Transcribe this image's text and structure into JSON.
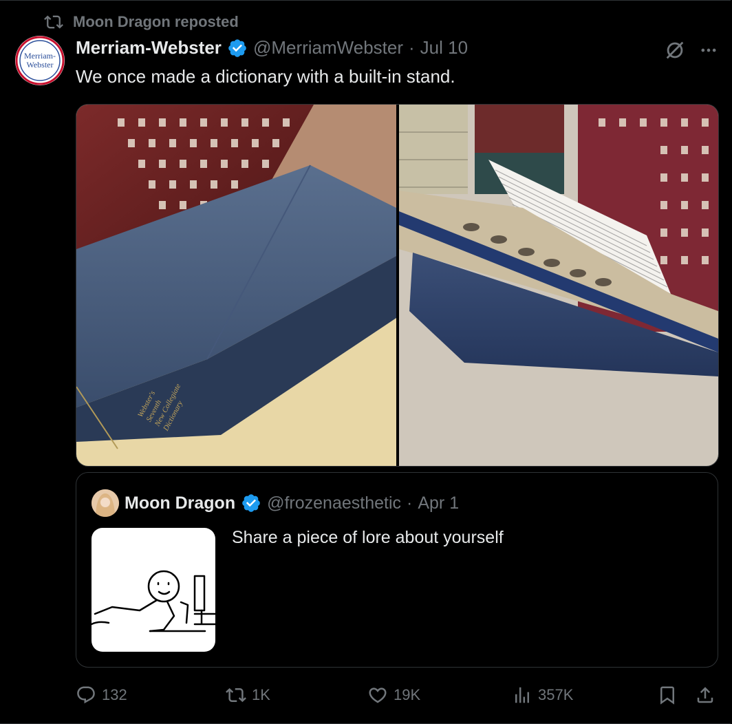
{
  "repost": {
    "text": "Moon Dragon reposted"
  },
  "post": {
    "author_name": "Merriam-Webster",
    "handle": "@MerriamWebster",
    "separator": "·",
    "date": "Jul 10",
    "text": "We once made a dictionary with a built-in stand.",
    "avatar_text_line1": "Merriam-",
    "avatar_text_line2": "Webster",
    "book_spine_text": [
      "Webster's",
      "Seventh",
      "New Collegiate",
      "Dictionary"
    ]
  },
  "quote": {
    "author_name": "Moon Dragon",
    "handle": "@frozenaesthetic",
    "separator": "·",
    "date": "Apr 1",
    "text": "Share a piece of lore about yourself"
  },
  "actions": {
    "replies": "132",
    "reposts": "1K",
    "likes": "19K",
    "views": "357K"
  },
  "colors": {
    "background": "#000000",
    "text": "#e7e9ea",
    "muted": "#71767b",
    "verified": "#1d9bf0",
    "border": "#2f3336"
  },
  "icons": [
    "repost-icon",
    "verified-badge-icon",
    "grok-icon",
    "more-icon",
    "reply-icon",
    "like-icon",
    "views-icon",
    "bookmark-icon",
    "share-icon"
  ]
}
